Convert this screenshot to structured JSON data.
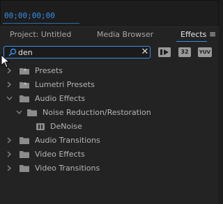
{
  "timecode": "00;00;00;00",
  "tabs": {
    "project": "Project: Untitled",
    "media_browser": "Media Browser",
    "effects": "Effects",
    "menu_icon": "hamburger-menu-icon"
  },
  "search": {
    "value": "den",
    "placeholder": ""
  },
  "filters": {
    "accelerated": "accelerated-effects-icon",
    "bit32_label": "32",
    "yuv_label": "YUV"
  },
  "tree": [
    {
      "label": "Presets",
      "expanded": false,
      "icon": "preset-folder-icon"
    },
    {
      "label": "Lumetri Presets",
      "expanded": false,
      "icon": "preset-folder-icon"
    },
    {
      "label": "Audio Effects",
      "expanded": true,
      "icon": "folder-icon"
    },
    {
      "label": "Noise Reduction/Restoration",
      "expanded": true,
      "icon": "folder-icon"
    },
    {
      "label": "DeNoise",
      "icon": "audio-effect-icon"
    },
    {
      "label": "Audio Transitions",
      "expanded": false,
      "icon": "folder-icon"
    },
    {
      "label": "Video Effects",
      "expanded": false,
      "icon": "folder-icon"
    },
    {
      "label": "Video Transitions",
      "expanded": false,
      "icon": "folder-icon"
    }
  ],
  "colors": {
    "accent": "#3a8ee8",
    "panel_bg": "#232323",
    "text": "#b4b4b4"
  }
}
